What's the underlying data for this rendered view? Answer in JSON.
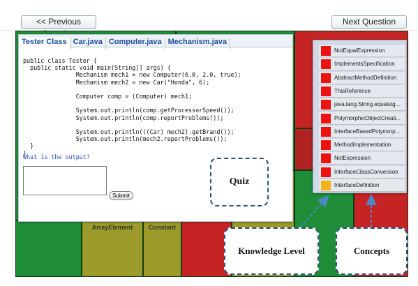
{
  "nav": {
    "prev_label": "<< Previous Question",
    "next_label": "Next Question >>"
  },
  "treemap": {
    "labels": [
      "ArrayElement",
      "Constant"
    ]
  },
  "quiz": {
    "tabs": [
      {
        "label": "Tester Class",
        "active": true
      },
      {
        "label": "Car.java",
        "active": false
      },
      {
        "label": "Computer.java",
        "active": false
      },
      {
        "label": "Mechanism.java",
        "active": false
      }
    ],
    "code": "public class Tester {\n  public static void main(String[] args) {\n               Mechanism mech1 = new Computer(6.0, 2.0, true);\n               Mechanism mech2 = new Car(\"Honda\", 6);\n\n               Computer comp = (Computer) mech1;\n\n               System.out.println(comp.getProcessorSpeed());\n               System.out.println(comp.reportProblems());\n\n               System.out.println(((Car) mech2).getBrand());\n               System.out.println(mech2.reportProblems());\n  }\n}",
    "question": "What is the output?",
    "answer_value": "",
    "submit_label": "Submit"
  },
  "concepts": {
    "items": [
      {
        "label": "NotEqualExpression",
        "color": "#ee1111"
      },
      {
        "label": "ImplementsSpecification",
        "color": "#ee1111"
      },
      {
        "label": "AbstractMethodDefinition",
        "color": "#ee1111"
      },
      {
        "label": "ThisReference",
        "color": "#ee1111"
      },
      {
        "label": "java.lang.String.equalsIg...",
        "color": "#ee1111"
      },
      {
        "label": "PolymorphicObjectCreati...",
        "color": "#ee1111"
      },
      {
        "label": "InterfaceBasedPolymorp...",
        "color": "#ee1111"
      },
      {
        "label": "MethodImplementation",
        "color": "#ee1111"
      },
      {
        "label": "NotExpression",
        "color": "#ee1111"
      },
      {
        "label": "InterfaceClassConversion",
        "color": "#ee1111"
      },
      {
        "label": "InterfaceDefinition",
        "color": "#f3b21a"
      }
    ]
  },
  "callouts": {
    "quiz": "Quiz",
    "knowledge": "Knowledge Level",
    "concepts": "Concepts"
  },
  "colors": {
    "treemap_green": "#1f8d38",
    "treemap_red": "#c62424",
    "treemap_olive": "#9c9a2a",
    "callout_border": "#2e4f82"
  }
}
